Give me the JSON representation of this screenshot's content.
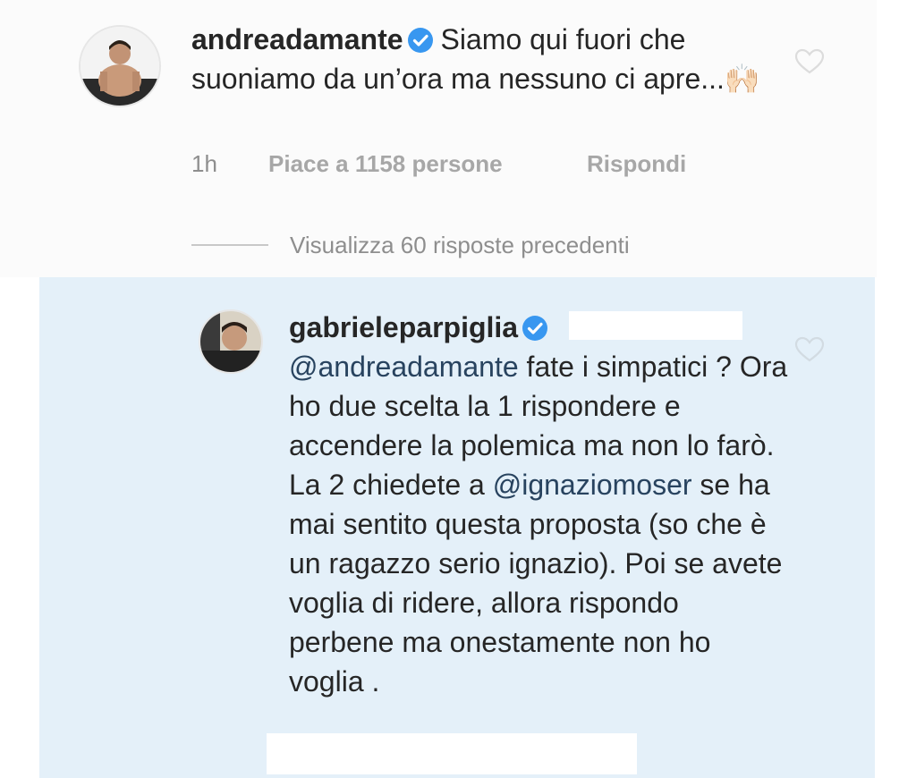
{
  "comment": {
    "username": "andreadamante",
    "text": "Siamo qui fuori che suoniamo da un’ora ma nessuno ci apre...",
    "emoji": "🙌🏻",
    "time": "1h",
    "likes_label": "Piace a 1158 persone",
    "reply_label": "Rispondi",
    "avatar_icon": "profile-photo",
    "verified_icon": "verified-badge",
    "like_icon": "heart-outline-icon"
  },
  "view_replies": {
    "label": "Visualizza 60 risposte precedenti"
  },
  "reply": {
    "username": "gabrieleparpiglia",
    "mention_user": "@andreadamante",
    "text_part1": " fate i simpatici ? Ora ho due scelta la 1 rispondere e accendere la polemica ma non lo farò. La 2 chiedete a ",
    "mention2": "@ignaziomoser",
    "text_part2": " se ha mai sentito questa proposta (so che è un ragazzo serio ignazio). Poi se avete voglia di ridere, allora rispondo perbene ma onestamente non ho voglia .",
    "avatar_icon": "profile-photo",
    "verified_icon": "verified-badge",
    "like_icon": "heart-outline-icon"
  },
  "colors": {
    "reply_background": "#e4f0f9",
    "verified_blue": "#3897f0",
    "mention": "#28435f",
    "meta_gray": "#a7a7a7"
  }
}
